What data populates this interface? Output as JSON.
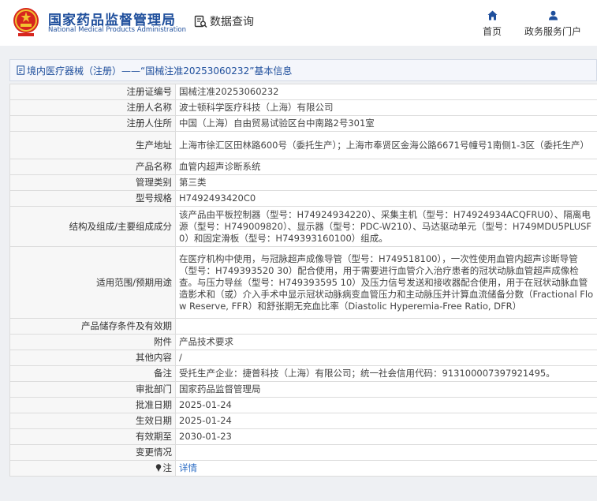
{
  "header": {
    "logo_cn": "国家药品监督管理局",
    "logo_en": "National Medical Products Administration",
    "search_label": "数据查询",
    "nav_home": "首页",
    "nav_gov": "政务服务门户"
  },
  "breadcrumb": "境内医疗器械（注册）——“国械注准20253060232”基本信息",
  "rows": [
    {
      "label": "注册证编号",
      "value": "国械注准20253060232"
    },
    {
      "label": "注册人名称",
      "value": "波士顿科学医疗科技（上海）有限公司"
    },
    {
      "label": "注册人住所",
      "value": "中国（上海）自由贸易试验区台中南路2号301室"
    },
    {
      "label": "生产地址",
      "value": "上海市徐汇区田林路600号（委托生产）；上海市奉贤区金海公路6671号幢号1南侧1-3区（委托生产）"
    },
    {
      "label": "产品名称",
      "value": "血管内超声诊断系统"
    },
    {
      "label": "管理类别",
      "value": "第三类"
    },
    {
      "label": "型号规格",
      "value": "H7492493420C0"
    },
    {
      "label": "结构及组成/主要组成成分",
      "value": "该产品由平板控制器（型号：H74924934220）、采集主机（型号：H74924934ACQFRU0）、隔离电源（型号：H749009820）、显示器（型号：PDC-W210）、马达驱动单元（型号：H749MDU5PLUSF0）和固定滑板（型号：H749393160100）组成。"
    },
    {
      "label": "适用范围/预期用途",
      "value": "在医疗机构中使用，与冠脉超声成像导管（型号：H749518100），一次性使用血管内超声诊断导管（型号：H749393520 30）配合使用，用于需要进行血管介入治疗患者的冠状动脉血管超声成像检查。与压力导丝（型号：H749393595 10）及压力信号发送和接收器配合使用，用于在冠状动脉血管造影术和（或）介入手术中显示冠状动脉病变血管压力和主动脉压并计算血流储备分数（Fractional Flow Reserve, FFR）和舒张期无充血比率（Diastolic Hyperemia-Free Ratio, DFR）"
    },
    {
      "label": "产品储存条件及有效期",
      "value": ""
    },
    {
      "label": "附件",
      "value": "产品技术要求"
    },
    {
      "label": "其他内容",
      "value": "/"
    },
    {
      "label": "备注",
      "value": "受托生产企业：捷普科技（上海）有限公司；统一社会信用代码：913100007397921495。"
    },
    {
      "label": "审批部门",
      "value": "国家药品监督管理局"
    },
    {
      "label": "批准日期",
      "value": "2025-01-24"
    },
    {
      "label": "生效日期",
      "value": "2025-01-24"
    },
    {
      "label": "有效期至",
      "value": "2030-01-23"
    },
    {
      "label": "变更情况",
      "value": ""
    },
    {
      "label": "注",
      "value": "详情"
    }
  ],
  "colors": {
    "brand_blue": "#1f4f9c",
    "link_blue": "#2b6cc4",
    "emblem_red": "#d7261e",
    "emblem_gold": "#f2c230"
  },
  "icons": [
    "emblem-icon",
    "search-doc-icon",
    "home-icon",
    "user-icon",
    "document-icon",
    "pin-icon"
  ]
}
